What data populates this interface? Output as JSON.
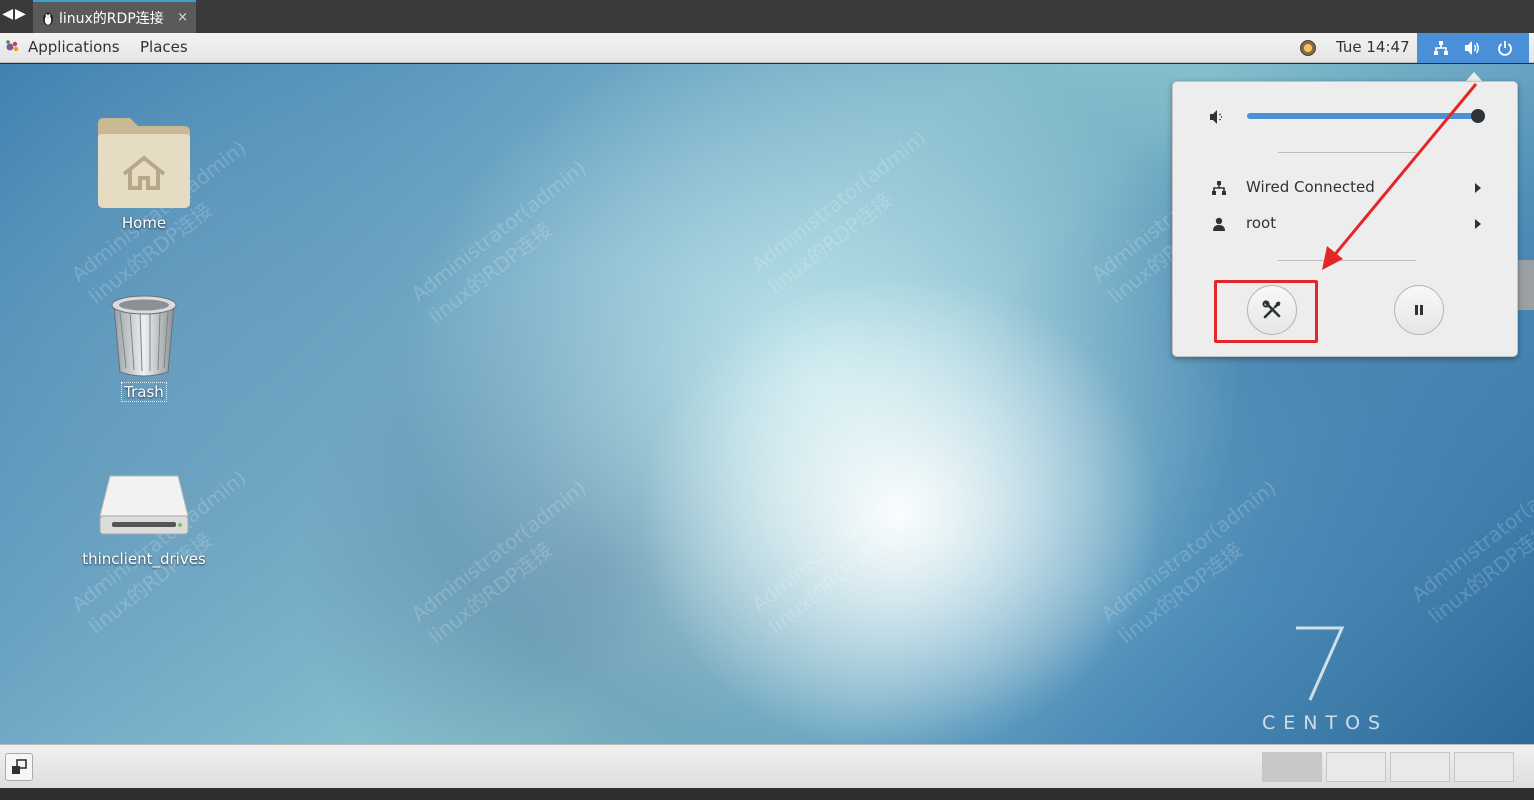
{
  "rdp": {
    "tab_title": "linux的RDP连接",
    "close_glyph": "×",
    "prev_glyph": "◀",
    "next_glyph": "▶"
  },
  "top_panel": {
    "applications": "Applications",
    "places": "Places",
    "clock": "Tue 14:47",
    "status_icons": [
      "network-wired-icon",
      "volume-icon",
      "power-icon"
    ]
  },
  "desktop": {
    "icons": [
      {
        "label": "Home",
        "icon": "home-folder-icon"
      },
      {
        "label": "Trash",
        "icon": "trash-icon"
      },
      {
        "label": "thinclient_drives",
        "icon": "drive-icon"
      }
    ],
    "watermark": [
      "Administrator(admin)",
      "linux的RDP连接"
    ],
    "logo": {
      "number": "7",
      "text": "CENTOS"
    }
  },
  "system_menu": {
    "volume_level": 0.98,
    "items": [
      {
        "label": "Wired Connected",
        "icon": "network-wired-icon"
      },
      {
        "label": "root",
        "icon": "user-icon"
      }
    ],
    "buttons": [
      "settings-tools-icon",
      "pause-icon"
    ]
  },
  "colors": {
    "accent": "#4a90d9",
    "annotation": "#e52626"
  },
  "bottom_panel": {
    "workspaces": 4,
    "active_workspace": 1
  }
}
